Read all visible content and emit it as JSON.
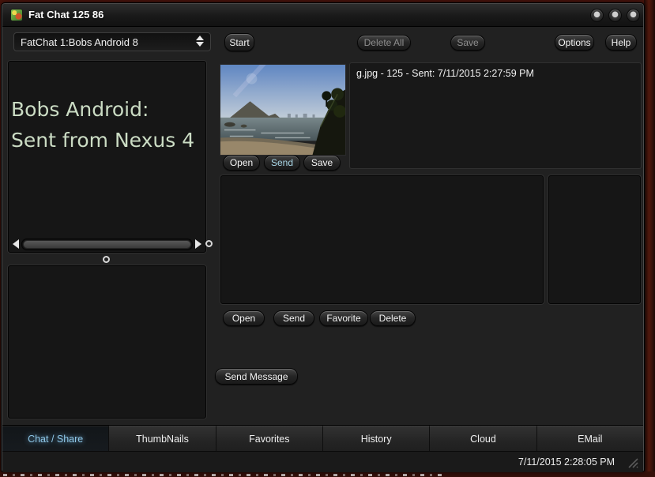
{
  "window": {
    "title": "Fat Chat 125 86"
  },
  "toolbar": {
    "session": "FatChat 1:Bobs Android 8",
    "start": "Start",
    "delete_all": "Delete All",
    "save": "Save",
    "options": "Options",
    "help": "Help"
  },
  "chat": {
    "line1": "Bobs Android:",
    "line2": "Sent from Nexus 4"
  },
  "message": {
    "info": "g.jpg - 125 - Sent: 7/11/2015 2:27:59 PM",
    "thumbnail_alt": "coastal beach photo thumbnail",
    "open": "Open",
    "send": "Send",
    "save": "Save"
  },
  "actions": {
    "open": "Open",
    "send": "Send",
    "favorite": "Favorite",
    "delete": "Delete",
    "send_message": "Send Message"
  },
  "tabs": [
    {
      "label": "Chat / Share",
      "active": true
    },
    {
      "label": "ThumbNails",
      "active": false
    },
    {
      "label": "Favorites",
      "active": false
    },
    {
      "label": "History",
      "active": false
    },
    {
      "label": "Cloud",
      "active": false
    },
    {
      "label": "EMail",
      "active": false
    }
  ],
  "status": {
    "timestamp": "7/11/2015 2:28:05 PM"
  },
  "colors": {
    "active_tab_text": "#8ec6e6",
    "chat_text": "#cbdcc4",
    "send_button_text": "#a9d6e6",
    "disabled_button_text": "#8f8f8f",
    "desktop_red": "#4a140c"
  }
}
